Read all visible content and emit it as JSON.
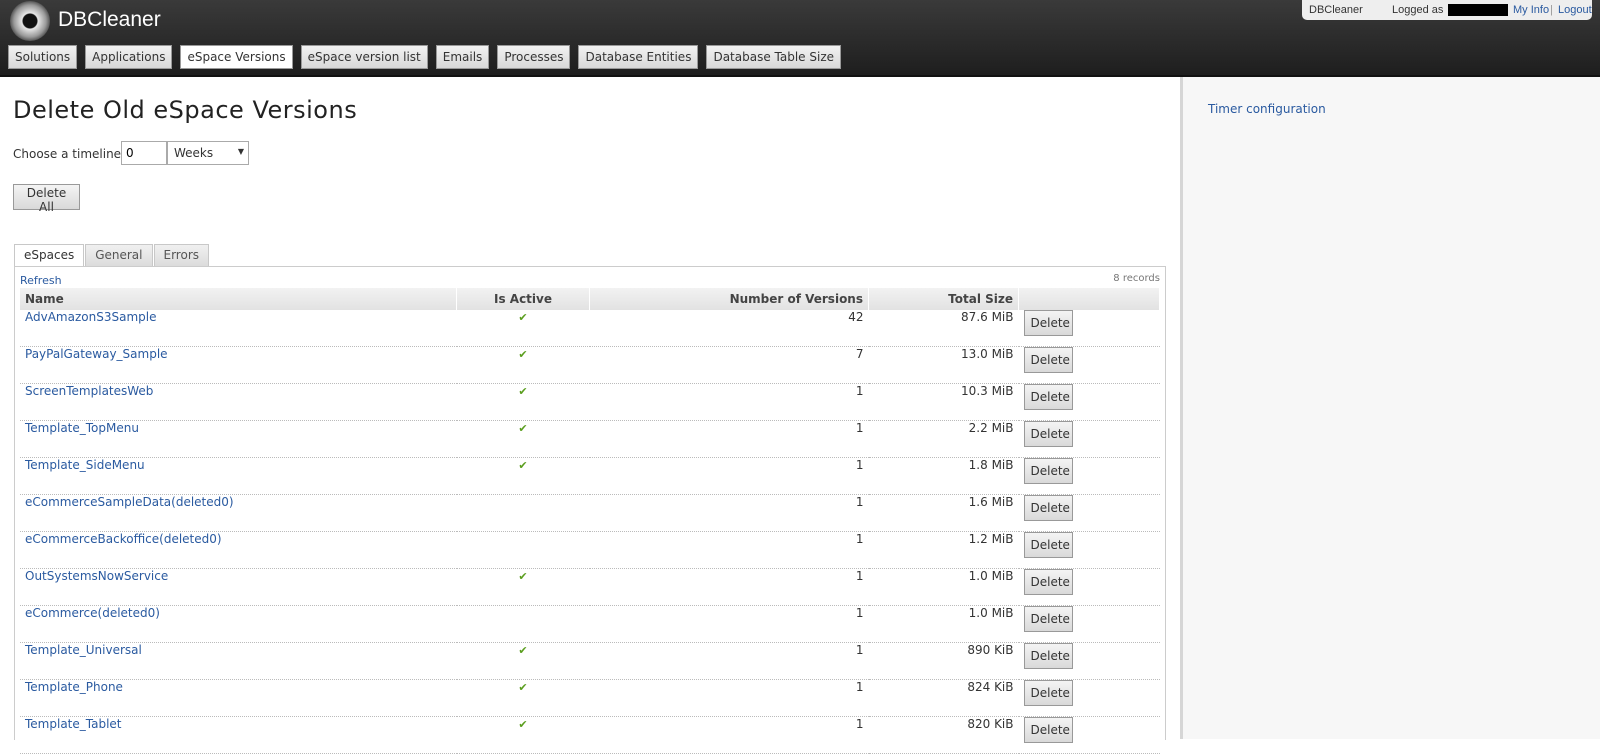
{
  "header": {
    "app_title": "DBCleaner",
    "login": {
      "app": "DBCleaner",
      "logged_as": "Logged as",
      "my_info": "My Info",
      "separator": "|",
      "logout": "Logout"
    },
    "nav": [
      "Solutions",
      "Applications",
      "eSpace Versions",
      "eSpace version list",
      "Emails",
      "Processes",
      "Database Entities",
      "Database Table Size"
    ],
    "active_nav": "eSpace Versions"
  },
  "main": {
    "title": "Delete Old eSpace Versions",
    "timeline_label": "Choose a timeline:",
    "timeline_value": "0",
    "timeline_unit": "Weeks",
    "delete_all": "Delete All",
    "tabs": [
      "eSpaces",
      "General",
      "Errors"
    ],
    "active_tab": "eSpaces",
    "refresh": "Refresh",
    "records": "8 records",
    "columns": {
      "name": "Name",
      "active": "Is Active",
      "versions": "Number of Versions",
      "size": "Total Size"
    },
    "delete_label": "Delete",
    "rows": [
      {
        "name": "AdvAmazonS3Sample",
        "active": true,
        "versions": "42",
        "size": "87.6 MiB"
      },
      {
        "name": "PayPalGateway_Sample",
        "active": true,
        "versions": "7",
        "size": "13.0 MiB"
      },
      {
        "name": "ScreenTemplatesWeb",
        "active": true,
        "versions": "1",
        "size": "10.3 MiB"
      },
      {
        "name": "Template_TopMenu",
        "active": true,
        "versions": "1",
        "size": "2.2 MiB"
      },
      {
        "name": "Template_SideMenu",
        "active": true,
        "versions": "1",
        "size": "1.8 MiB"
      },
      {
        "name": "eCommerceSampleData(deleted0)",
        "active": false,
        "versions": "1",
        "size": "1.6 MiB"
      },
      {
        "name": "eCommerceBackoffice(deleted0)",
        "active": false,
        "versions": "1",
        "size": "1.2 MiB"
      },
      {
        "name": "OutSystemsNowService",
        "active": true,
        "versions": "1",
        "size": "1.0 MiB"
      },
      {
        "name": "eCommerce(deleted0)",
        "active": false,
        "versions": "1",
        "size": "1.0 MiB"
      },
      {
        "name": "Template_Universal",
        "active": true,
        "versions": "1",
        "size": "890 KiB"
      },
      {
        "name": "Template_Phone",
        "active": true,
        "versions": "1",
        "size": "824 KiB"
      },
      {
        "name": "Template_Tablet",
        "active": true,
        "versions": "1",
        "size": "820 KiB"
      }
    ]
  },
  "sidebar": {
    "timer_link": "Timer configuration"
  },
  "icons": {
    "logo": "disc-logo-icon",
    "check": "check-icon",
    "dropdown": "dropdown-arrow-icon"
  },
  "colors": {
    "header": "#2b2b2b",
    "link": "#2a5aa0",
    "check": "#5a9e1e"
  }
}
